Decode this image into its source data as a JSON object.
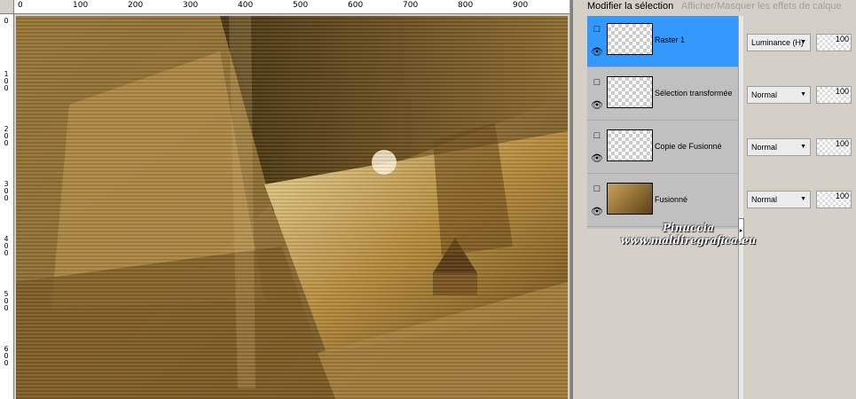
{
  "ruler": {
    "top_labels": [
      "0",
      "100",
      "200",
      "300",
      "400",
      "500",
      "600",
      "700",
      "800",
      "900"
    ],
    "left_labels": [
      "0",
      "1 0 0",
      "2 0 0",
      "3 0 0",
      "4 0 0",
      "5 0 0",
      "6 0 0"
    ]
  },
  "layers_panel": {
    "title": "Modifier la sélection",
    "effects_link": "Afficher/Masquer les effets de calque",
    "layers": [
      {
        "name": "Raster 1",
        "blend": "Luminance (H)",
        "opacity": "100",
        "selected": true
      },
      {
        "name": "Sélection transformée",
        "blend": "Normal",
        "opacity": "100",
        "selected": false
      },
      {
        "name": "Copie de Fusionné",
        "blend": "Normal",
        "opacity": "100",
        "selected": false
      },
      {
        "name": "Fusionné",
        "blend": "Normal",
        "opacity": "100",
        "selected": false
      }
    ]
  },
  "watermark": {
    "line1": "Pinuccia",
    "line2": "www.maldiregrafica.eu"
  },
  "colors": {
    "selection": "#3399ff",
    "canvas_brown": "#8a6428",
    "panel_bg": "#d4d0c8"
  }
}
